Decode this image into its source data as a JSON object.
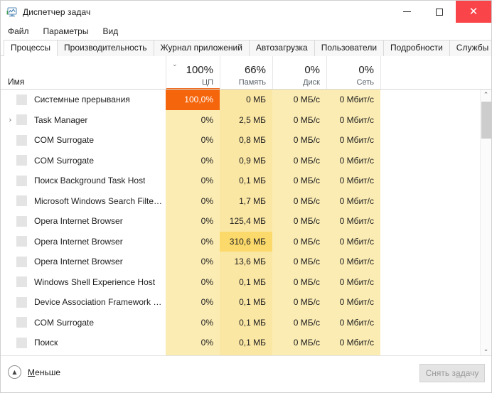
{
  "window": {
    "title": "Диспетчер задач",
    "icon": "task-manager-icon",
    "controls": {
      "minimize": "—",
      "maximize": "☐",
      "close": "✕"
    }
  },
  "menubar": {
    "items": [
      {
        "label": "Файл"
      },
      {
        "label": "Параметры"
      },
      {
        "label": "Вид"
      }
    ]
  },
  "tabs": [
    {
      "label": "Процессы",
      "active": true
    },
    {
      "label": "Производительность",
      "active": false
    },
    {
      "label": "Журнал приложений",
      "active": false
    },
    {
      "label": "Автозагрузка",
      "active": false
    },
    {
      "label": "Пользователи",
      "active": false
    },
    {
      "label": "Подробности",
      "active": false
    },
    {
      "label": "Службы",
      "active": false
    }
  ],
  "table": {
    "columns": [
      {
        "key": "name",
        "label": "Имя",
        "percent": "",
        "sorted": false
      },
      {
        "key": "cpu",
        "label": "ЦП",
        "percent": "100%",
        "sorted": true
      },
      {
        "key": "memory",
        "label": "Память",
        "percent": "66%",
        "sorted": false
      },
      {
        "key": "disk",
        "label": "Диск",
        "percent": "0%",
        "sorted": false
      },
      {
        "key": "network",
        "label": "Сеть",
        "percent": "0%",
        "sorted": false
      }
    ],
    "sort_chevron": "⌄",
    "rows": [
      {
        "name": "Системные прерывания",
        "expandable": false,
        "cpu": "100,0%",
        "cpu_state": "hot",
        "memory": "0 МБ",
        "memory_state": "normal",
        "disk": "0 МБ/с",
        "network": "0 Мбит/с"
      },
      {
        "name": "Task Manager",
        "expandable": true,
        "cpu": "0%",
        "cpu_state": "normal",
        "memory": "2,5 МБ",
        "memory_state": "normal",
        "disk": "0 МБ/с",
        "network": "0 Мбит/с"
      },
      {
        "name": "COM Surrogate",
        "expandable": false,
        "cpu": "0%",
        "cpu_state": "normal",
        "memory": "0,8 МБ",
        "memory_state": "normal",
        "disk": "0 МБ/с",
        "network": "0 Мбит/с"
      },
      {
        "name": "COM Surrogate",
        "expandable": false,
        "cpu": "0%",
        "cpu_state": "normal",
        "memory": "0,9 МБ",
        "memory_state": "normal",
        "disk": "0 МБ/с",
        "network": "0 Мбит/с"
      },
      {
        "name": "Поиск Background Task Host",
        "expandable": false,
        "cpu": "0%",
        "cpu_state": "normal",
        "memory": "0,1 МБ",
        "memory_state": "normal",
        "disk": "0 МБ/с",
        "network": "0 Мбит/с"
      },
      {
        "name": "Microsoft Windows Search Filte…",
        "expandable": false,
        "cpu": "0%",
        "cpu_state": "normal",
        "memory": "1,7 МБ",
        "memory_state": "normal",
        "disk": "0 МБ/с",
        "network": "0 Мбит/с"
      },
      {
        "name": "Opera Internet Browser",
        "expandable": false,
        "cpu": "0%",
        "cpu_state": "normal",
        "memory": "125,4 МБ",
        "memory_state": "normal",
        "disk": "0 МБ/с",
        "network": "0 Мбит/с"
      },
      {
        "name": "Opera Internet Browser",
        "expandable": false,
        "cpu": "0%",
        "cpu_state": "normal",
        "memory": "310,6 МБ",
        "memory_state": "warm",
        "disk": "0 МБ/с",
        "network": "0 Мбит/с"
      },
      {
        "name": "Opera Internet Browser",
        "expandable": false,
        "cpu": "0%",
        "cpu_state": "normal",
        "memory": "13,6 МБ",
        "memory_state": "normal",
        "disk": "0 МБ/с",
        "network": "0 Мбит/с"
      },
      {
        "name": "Windows Shell Experience Host",
        "expandable": false,
        "cpu": "0%",
        "cpu_state": "normal",
        "memory": "0,1 МБ",
        "memory_state": "normal",
        "disk": "0 МБ/с",
        "network": "0 Мбит/с"
      },
      {
        "name": "Device Association Framework …",
        "expandable": false,
        "cpu": "0%",
        "cpu_state": "normal",
        "memory": "0,1 МБ",
        "memory_state": "normal",
        "disk": "0 МБ/с",
        "network": "0 Мбит/с"
      },
      {
        "name": "COM Surrogate",
        "expandable": false,
        "cpu": "0%",
        "cpu_state": "normal",
        "memory": "0,1 МБ",
        "memory_state": "normal",
        "disk": "0 МБ/с",
        "network": "0 Мбит/с"
      },
      {
        "name": "Поиск",
        "expandable": false,
        "cpu": "0%",
        "cpu_state": "normal",
        "memory": "0,1 МБ",
        "memory_state": "normal",
        "disk": "0 МБ/с",
        "network": "0 Мбит/с"
      },
      {
        "name": "",
        "expandable": false,
        "cpu": "",
        "cpu_state": "normal",
        "memory": "",
        "memory_state": "normal",
        "disk": "",
        "network": ""
      }
    ]
  },
  "scrollbar": {
    "up_arrow": "⌃",
    "down_arrow": "⌄"
  },
  "footer": {
    "less_label_accel": "М",
    "less_label_rest": "еньше",
    "less_icon": "chevron-up-circle-icon",
    "end_task_pre": "Снять з",
    "end_task_accel": "а",
    "end_task_post": "дачу"
  },
  "colors": {
    "accent_orange": "#f26d21",
    "cpu_hot": "#f4650c",
    "cell_amber": "#fbecb4",
    "cell_amber_mem": "#fbe7a4",
    "cell_amber_warm": "#fbd96b",
    "close_red": "#f94449"
  }
}
